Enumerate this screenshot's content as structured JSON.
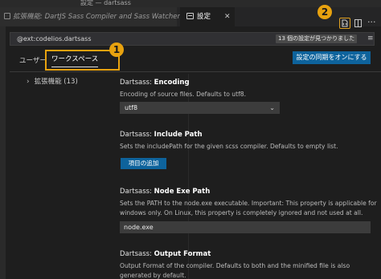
{
  "window": {
    "title": "設定 — dartsass"
  },
  "tabs": [
    {
      "label": "拡張機能: DartJS Sass Compiler and Sass Watcher"
    },
    {
      "label": "設定",
      "close": "✕"
    }
  ],
  "callouts": {
    "one": "1",
    "two": "2"
  },
  "more_glyph": "···",
  "search": {
    "value": "@ext:codelios.dartsass",
    "result_count": "13 個の設定が見つかりました",
    "clear_glyph": "≡"
  },
  "scope": {
    "user": "ユーザー",
    "workspace": "ワークスペース"
  },
  "sync_button": "設定の同期をオンにする",
  "toc": {
    "item": "拡張機能 (13)",
    "chevron": "›"
  },
  "settings": {
    "encoding": {
      "prefix": "Dartsass: ",
      "name": "Encoding",
      "description": "Encoding of source files. Defaults to utf8.",
      "value": "utf8"
    },
    "include": {
      "prefix": "Dartsass: ",
      "name": "Include Path",
      "description": "Sets the includePath for the given scss compiler. Defaults to empty list.",
      "button": "項目の追加"
    },
    "nodeexe": {
      "prefix": "Dartsass: ",
      "name": "Node Exe Path",
      "description": "Sets the PATH to the node.exe executable. Important: This property is applicable for windows only. On Linux, this property is completely ignored and not used at all.",
      "value": "node.exe"
    },
    "output": {
      "prefix": "Dartsass: ",
      "name": "Output Format",
      "description": "Output Format of the compiler. Defaults to both and the minified file is also generated by default."
    }
  },
  "colors": {
    "accent": "#0e639c",
    "callout": "#e8a20f",
    "background": "#1e1e1e"
  },
  "icons": [
    "open-settings-json-icon",
    "split-editor-icon",
    "more-actions-icon",
    "settings-tab-icon",
    "extension-tab-icon",
    "filter-icon",
    "chevron-down-icon",
    "chevron-right-icon"
  ]
}
